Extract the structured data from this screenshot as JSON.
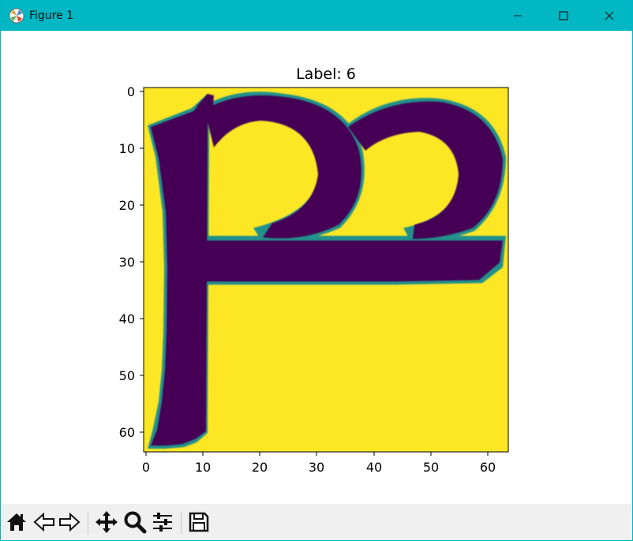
{
  "window": {
    "title": "Figure 1"
  },
  "figure": {
    "title": "Label: 6",
    "x_ticks": [
      "0",
      "10",
      "20",
      "30",
      "40",
      "50",
      "60"
    ],
    "y_ticks": [
      "0",
      "10",
      "20",
      "30",
      "40",
      "50",
      "60"
    ]
  },
  "chart_data": {
    "type": "heatmap",
    "title": "Label: 6",
    "image_size": [
      64,
      64
    ],
    "colormap": "viridis",
    "xlim": [
      -0.5,
      63.5
    ],
    "ylim": [
      63.5,
      -0.5
    ],
    "xticks": [
      0,
      10,
      20,
      30,
      40,
      50,
      60
    ],
    "yticks": [
      0,
      10,
      20,
      30,
      40,
      50,
      60
    ],
    "background_value": "high (yellow)",
    "glyph_value": "low (dark purple)",
    "colors": {
      "high": "#fde725",
      "low": "#440154",
      "mid": "#21918c"
    }
  },
  "toolbar": {
    "buttons": [
      "home-icon",
      "back-icon",
      "forward-icon",
      "pan-icon",
      "zoom-icon",
      "configure-icon",
      "save-icon"
    ]
  }
}
